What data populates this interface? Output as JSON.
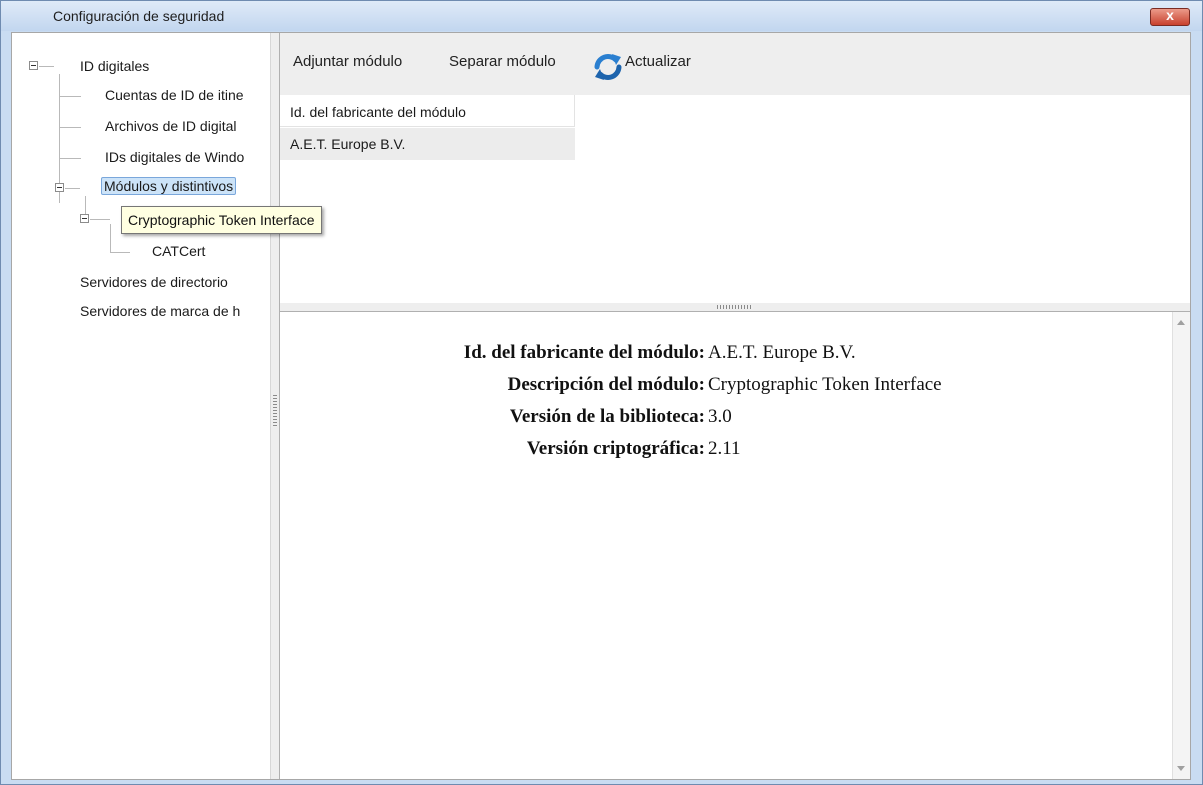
{
  "window": {
    "title": "Configuración de seguridad",
    "close_label": "x"
  },
  "tree": {
    "root": "ID digitales",
    "children": [
      "Cuentas de ID de itine",
      "Archivos de ID digital",
      "IDs digitales de Windo"
    ],
    "modules": "Módulos y distintivos",
    "catcert": "CATCert",
    "directory_servers": "Servidores de directorio",
    "timestamp_servers": "Servidores de marca de h"
  },
  "tooltip": {
    "text": "Cryptographic Token Interface"
  },
  "toolbar": {
    "attach": "Adjuntar módulo",
    "detach": "Separar módulo",
    "refresh": "Actualizar",
    "refresh_icon": "refresh-icon"
  },
  "table": {
    "header": "Id. del fabricante del módulo",
    "rows": [
      "A.E.T. Europe B.V."
    ]
  },
  "details": {
    "rows": [
      {
        "label": "Id. del fabricante del módulo:",
        "value": "A.E.T. Europe B.V."
      },
      {
        "label": "Descripción del módulo:",
        "value": "Cryptographic Token Interface"
      },
      {
        "label": "Versión de la biblioteca:",
        "value": "3.0"
      },
      {
        "label": "Versión criptográfica:",
        "value": "2.11"
      }
    ]
  },
  "colors": {
    "selection": "#cce3f8",
    "tooltip_bg": "#ffffe1",
    "toolbar_bg": "#eeeeee",
    "refresh_blue": "#2a7fd0"
  }
}
